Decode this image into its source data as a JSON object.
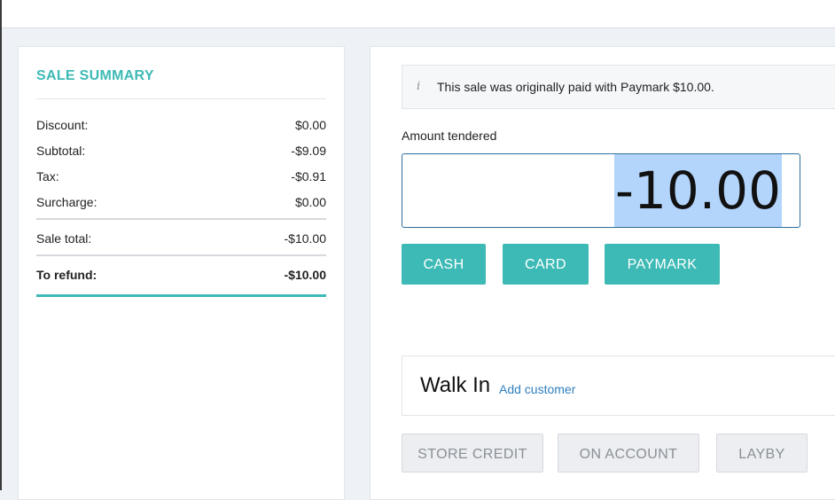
{
  "summary": {
    "title": "SALE SUMMARY",
    "rows": [
      {
        "label": "Discount:",
        "value": "$0.00"
      },
      {
        "label": "Subtotal:",
        "value": "-$9.09"
      },
      {
        "label": "Tax:",
        "value": "-$0.91"
      },
      {
        "label": "Surcharge:",
        "value": "$0.00"
      }
    ],
    "sale_total": {
      "label": "Sale total:",
      "value": "-$10.00"
    },
    "to_refund": {
      "label": "To refund:",
      "value": "-$10.00"
    }
  },
  "info": {
    "icon": "info-icon",
    "icon_glyph": "i",
    "text": "This sale was originally paid with Paymark $10.00."
  },
  "amount": {
    "label": "Amount tendered",
    "value": "-10.00"
  },
  "payment_buttons": {
    "cash": "CASH",
    "card": "CARD",
    "paymark": "PAYMARK"
  },
  "customer": {
    "name": "Walk In",
    "add_link": "Add customer"
  },
  "other_buttons": {
    "store_credit": "STORE CREDIT",
    "on_account": "ON ACCOUNT",
    "layby": "LAYBY"
  },
  "colors": {
    "accent": "#3dbab5",
    "link": "#2f7fbf",
    "selection": "#b3d4fb"
  }
}
